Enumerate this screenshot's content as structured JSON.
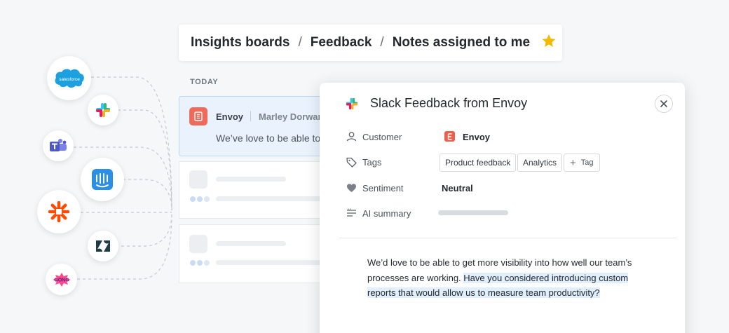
{
  "breadcrumb": {
    "items": [
      "Insights boards",
      "Feedback",
      "Notes assigned to me"
    ],
    "separator": "/"
  },
  "integrations": [
    {
      "name": "salesforce",
      "label": "salesforce",
      "color": "#1ba1e0"
    },
    {
      "name": "slack"
    },
    {
      "name": "microsoft-teams",
      "color": "#4f59c6"
    },
    {
      "name": "intercom",
      "color": "#2c8fe6"
    },
    {
      "name": "zapier",
      "color": "#ff4a00"
    },
    {
      "name": "zendesk",
      "color": "#1f3b47"
    },
    {
      "name": "gong",
      "label": "GONG",
      "color": "#8a2be2"
    }
  ],
  "notes_list": {
    "day_label": "TODAY",
    "active_note": {
      "company": "Envoy",
      "author": "Marley Dorwart",
      "snippet": "We’ve love to be able to"
    }
  },
  "detail": {
    "title": "Slack Feedback from Envoy",
    "fields": {
      "customer": {
        "label": "Customer",
        "value": "Envoy"
      },
      "tags": {
        "label": "Tags",
        "items": [
          "Product feedback",
          "Analytics"
        ],
        "add_label": "Tag"
      },
      "sentiment": {
        "label": "Sentiment",
        "value": "Neutral"
      },
      "ai_summary": {
        "label": "AI summary"
      }
    },
    "body": {
      "plain": "We’d love to be able to get more visibility into how well our team’s processes are working. ",
      "highlighted": "Have you considered introducing custom reports that would allow us to measure team productivity?"
    }
  },
  "colors": {
    "accent_highlight": "#e1eefc",
    "star": "#f5b800",
    "envoy_brand": "#ee5e4c",
    "active_note_bg": "#eaf3fd"
  }
}
